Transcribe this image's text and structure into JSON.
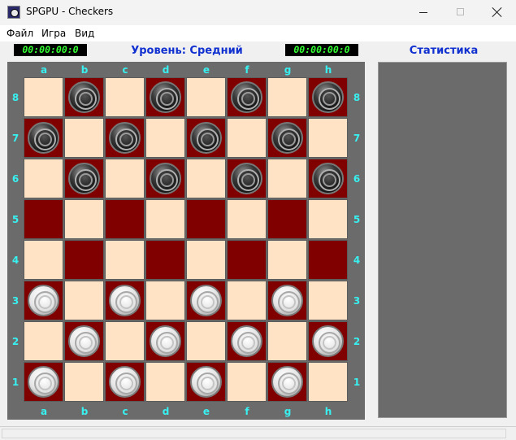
{
  "window": {
    "title": "SPGPU - Checkers",
    "icon": "checkers-app-icon"
  },
  "menu": [
    {
      "label": "Файл"
    },
    {
      "label": "Игра"
    },
    {
      "label": "Вид"
    }
  ],
  "header": {
    "left_timer": "00:00:00:0",
    "right_timer": "00:00:00:0",
    "level_label": "Уровень: Средний",
    "stats_title": "Статистика"
  },
  "board": {
    "files": [
      "a",
      "b",
      "c",
      "d",
      "e",
      "f",
      "g",
      "h"
    ],
    "ranks": [
      "8",
      "7",
      "6",
      "5",
      "4",
      "3",
      "2",
      "1"
    ],
    "colors": {
      "light": "#ffe3c4",
      "dark": "#800000",
      "frame": "#6b6b6b",
      "coords": "#39f0f0"
    },
    "pieces": [
      {
        "square": "b8",
        "color": "black"
      },
      {
        "square": "d8",
        "color": "black"
      },
      {
        "square": "f8",
        "color": "black"
      },
      {
        "square": "h8",
        "color": "black"
      },
      {
        "square": "a7",
        "color": "black"
      },
      {
        "square": "c7",
        "color": "black"
      },
      {
        "square": "e7",
        "color": "black"
      },
      {
        "square": "g7",
        "color": "black"
      },
      {
        "square": "b6",
        "color": "black"
      },
      {
        "square": "d6",
        "color": "black"
      },
      {
        "square": "f6",
        "color": "black"
      },
      {
        "square": "h6",
        "color": "black"
      },
      {
        "square": "a3",
        "color": "white"
      },
      {
        "square": "c3",
        "color": "white"
      },
      {
        "square": "e3",
        "color": "white"
      },
      {
        "square": "g3",
        "color": "white"
      },
      {
        "square": "b2",
        "color": "white"
      },
      {
        "square": "d2",
        "color": "white"
      },
      {
        "square": "f2",
        "color": "white"
      },
      {
        "square": "h2",
        "color": "white"
      },
      {
        "square": "a1",
        "color": "white"
      },
      {
        "square": "c1",
        "color": "white"
      },
      {
        "square": "e1",
        "color": "white"
      },
      {
        "square": "g1",
        "color": "white"
      }
    ]
  }
}
